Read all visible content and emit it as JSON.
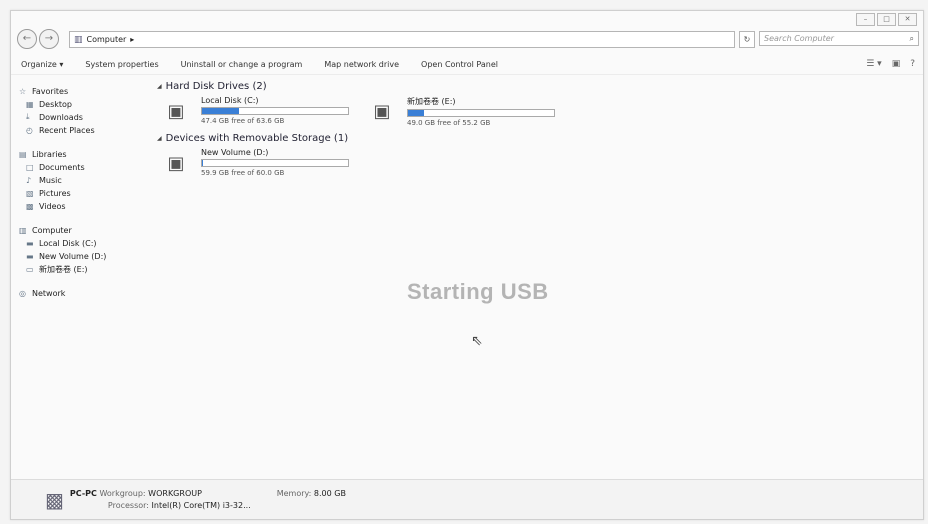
{
  "window": {
    "controls": [
      "–",
      "□",
      "✕"
    ]
  },
  "address": {
    "back_icon": "←",
    "forward_icon": "→",
    "crumb": "Computer",
    "arrow": "▸",
    "refresh_icon": "↻",
    "search_placeholder": "Search Computer",
    "search_icon": "⌕"
  },
  "toolbar": {
    "items": [
      "Organize ▾",
      "System properties",
      "Uninstall or change a program",
      "Map network drive",
      "Open Control Panel"
    ],
    "view_icon": "☰ ▾",
    "pane_icon": "▣",
    "help_icon": "?"
  },
  "nav": {
    "items": [
      {
        "label": "Favorites",
        "icon": "☆",
        "type": "head"
      },
      {
        "label": "Desktop",
        "icon": "▦",
        "type": "sub"
      },
      {
        "label": "Downloads",
        "icon": "⤓",
        "type": "sub"
      },
      {
        "label": "Recent Places",
        "icon": "◴",
        "type": "sub"
      },
      {
        "label": "Libraries",
        "icon": "▤",
        "type": "head"
      },
      {
        "label": "Documents",
        "icon": "□",
        "type": "sub"
      },
      {
        "label": "Music",
        "icon": "♪",
        "type": "sub"
      },
      {
        "label": "Pictures",
        "icon": "▧",
        "type": "sub"
      },
      {
        "label": "Videos",
        "icon": "▩",
        "type": "sub"
      },
      {
        "label": "Computer",
        "icon": "▥",
        "type": "head"
      },
      {
        "label": "Local Disk (C:)",
        "icon": "▬",
        "type": "sub"
      },
      {
        "label": "New Volume (D:)",
        "icon": "▬",
        "type": "sub"
      },
      {
        "label": "新加卷卷 (E:)",
        "icon": "▭",
        "type": "sub"
      },
      {
        "label": "Network",
        "icon": "◎",
        "type": "head"
      }
    ]
  },
  "content": {
    "hard_disk_header": "Hard Disk Drives (2)",
    "removable_header": "Devices with Removable Storage (1)",
    "hard_disks": [
      {
        "name": "Local Disk (C:)",
        "free": "47.4 GB free of 63.6 GB",
        "used_fraction": 0.25
      },
      {
        "name": "新加卷卷 (E:)",
        "free": "49.0 GB free of 55.2 GB",
        "used_fraction": 0.11
      }
    ],
    "removable": [
      {
        "name": "New Volume (D:)",
        "free": "59.9 GB free of 60.0 GB",
        "used_fraction": 0.01
      }
    ]
  },
  "overlay": {
    "text": "Starting USB",
    "cursor_icon": "⇖"
  },
  "details": {
    "pc_name": "PC-PC",
    "workgroup_label": "Workgroup:",
    "workgroup": "WORKGROUP",
    "memory_label": "Memory:",
    "memory": "8.00 GB",
    "processor_label": "Processor:",
    "processor": "Intel(R) Core(TM) i3-32..."
  },
  "colors": {
    "bar_fill": "#3a7fd6"
  }
}
